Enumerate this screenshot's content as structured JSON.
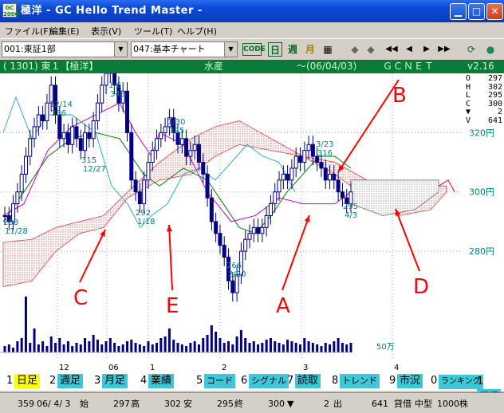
{
  "window": {
    "title": "極洋 - GC Hello Trend Master -",
    "app_icon": "GC\n2000"
  },
  "menu": [
    "ファイル(F)",
    "編集(E)",
    "表示(V)",
    "ツール(T)",
    "ヘルプ(H)"
  ],
  "toolbar": {
    "market_select": "001:東証1部",
    "chart_select": "047:基本チャート",
    "code_label": "CODE",
    "period_buttons": [
      "日",
      "週",
      "月"
    ],
    "icons": [
      "grid-icon",
      "arrow-left-icon",
      "arrow-right-icon",
      "rewind-icon",
      "step-back-icon",
      "step-forward-icon",
      "fast-forward-icon",
      "refresh-icon",
      "globe-icon"
    ]
  },
  "infobar": {
    "code": "( 1301) 東１【極洋】",
    "sector": "水産",
    "date": "〜(06/04/03)",
    "source": "ＧＣＮＥＴ",
    "version": "v2.16"
  },
  "ohlc": {
    "labels": [
      "O",
      "H",
      "L",
      "C"
    ],
    "values": [
      "297",
      "302",
      "295",
      "300"
    ],
    "change_symbol": "▼",
    "change": "2",
    "volume_label": "V",
    "volume": "641"
  },
  "chart_data": {
    "type": "candlestick",
    "y_ticks": [
      "320円",
      "300円",
      "280円"
    ],
    "ylim": [
      262,
      340
    ],
    "x_ticks": [
      "12",
      "06",
      "1",
      "2",
      "3",
      "4"
    ],
    "volume_label": "50万",
    "annotations": [
      {
        "text": "12/14",
        "value": "336"
      },
      {
        "text": "1/6",
        "value": "343"
      },
      {
        "text": "1/30",
        "value": "325"
      },
      {
        "text": "3/23",
        "value": "316"
      },
      {
        "text": "288",
        "value": "11/28"
      },
      {
        "text": "315",
        "value": "12/27"
      },
      {
        "text": "292",
        "value": "1/18"
      },
      {
        "text": "266",
        "value": "2/20"
      },
      {
        "text": "295",
        "value": "4/3"
      }
    ],
    "callouts": [
      "A",
      "B",
      "C",
      "D",
      "E"
    ],
    "colors": {
      "red": "#ff0000",
      "cloud": "#e06060",
      "tenkan": "#cc00cc",
      "kijun": "#008000",
      "chikou": "#33aacc",
      "candle": "#000080",
      "axis_text": "#008080",
      "annotation_text": "#008080"
    }
  },
  "tabs": [
    {
      "num": "1",
      "label": "日足",
      "active": true
    },
    {
      "num": "2",
      "label": "週足"
    },
    {
      "num": "3",
      "label": "月足"
    },
    {
      "num": "4",
      "label": "業績"
    },
    {
      "num": "5",
      "label": "コード"
    },
    {
      "num": "6",
      "label": "シグナル"
    },
    {
      "num": "7",
      "label": "読取"
    },
    {
      "num": "8",
      "label": "トレンド"
    },
    {
      "num": "9",
      "label": "市況"
    },
    {
      "num": "0",
      "label": "ランキング"
    },
    {
      "num": "1",
      "label": "相場"
    }
  ],
  "status": {
    "count": "359",
    "date": "06/ 4/ 3",
    "open_label": "始",
    "open": "297",
    "high_label": "高",
    "high": "302",
    "low_label": "安",
    "low": "295",
    "close_label": "終",
    "close": "300",
    "change_symbol": "▼",
    "change": "2",
    "volume_label": "出",
    "volume": "641",
    "lending": "貸借",
    "size": "中型",
    "unit": "1000株"
  }
}
